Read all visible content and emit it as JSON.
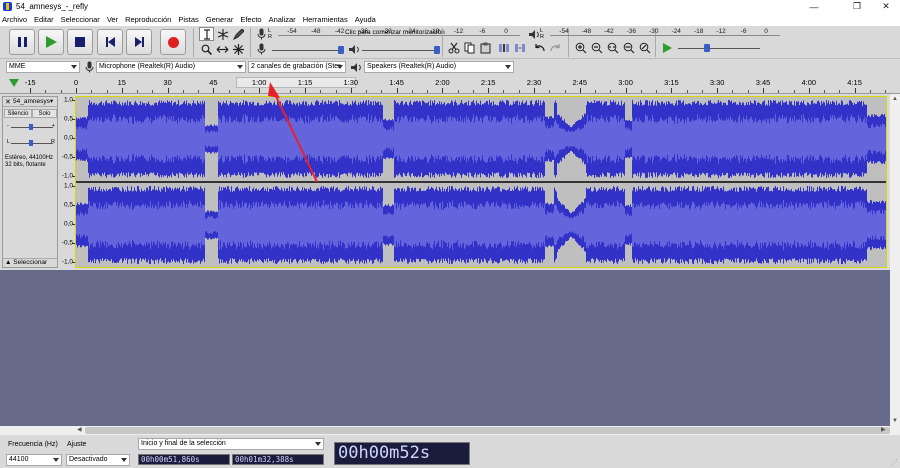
{
  "window": {
    "title": "54_amnesys_-_refly",
    "minimize": "—",
    "maximize": "❐",
    "close": "✕"
  },
  "menu": [
    "Archivo",
    "Editar",
    "Seleccionar",
    "Ver",
    "Reproducción",
    "Pistas",
    "Generar",
    "Efecto",
    "Analizar",
    "Herramientas",
    "Ayuda"
  ],
  "transport": {
    "pause": "Pausa",
    "play": "Reproducir",
    "stop": "Detener",
    "skip_start": "Saltar al inicio",
    "skip_end": "Saltar al final",
    "record": "Grabar"
  },
  "meters": {
    "record_ticks": [
      "-54",
      "-48",
      "-42",
      "-36",
      "-30",
      "-24",
      "-18",
      "-12",
      "-6",
      "0"
    ],
    "record_hint": "Clic para comenzar monitorización",
    "play_ticks": [
      "-54",
      "-48",
      "-42",
      "-36",
      "-30",
      "-24",
      "-18",
      "-12",
      "-6",
      "0"
    ],
    "lr_left": "L",
    "lr_right": "R"
  },
  "device": {
    "host": "MME",
    "mic": "Microphone (Realtek(R) Audio)",
    "channels": "2 canales de grabación (Ster",
    "speakers": "Speakers (Realtek(R) Audio)"
  },
  "ruler": {
    "labels": [
      "-15",
      "0",
      "15",
      "30",
      "45",
      "1:00",
      "1:15",
      "1:30",
      "1:45",
      "2:00",
      "2:15",
      "2:30",
      "2:45",
      "3:00",
      "3:15",
      "3:30",
      "3:45",
      "4:00",
      "4:15"
    ]
  },
  "track": {
    "name": "54_amnesys",
    "close": "✕",
    "dropdown": "▾",
    "mute": "Silencio",
    "solo": "Solo",
    "gain_minus": "-",
    "gain_plus": "+",
    "pan_left": "L",
    "pan_right": "R",
    "info_line1": "Estéreo, 44100Hz",
    "info_line2": "32 bits, flotante",
    "select": "Seleccionar",
    "collapse": "▲",
    "scale": [
      "1,0",
      "0,5",
      "0,0",
      "-0,5",
      "-1,0"
    ]
  },
  "selection_toolbar": {
    "rate_label": "Frecuencia (Hz)",
    "rate_value": "44100",
    "snap_label": "Ajuste",
    "snap_value": "Desactivado",
    "range_label": "Inicio y final de la selección",
    "start": "00h00m51,860s",
    "end": "00h01m32,388s",
    "position": "00h00m52s"
  },
  "colors": {
    "wave": "#3232c8",
    "wave_light": "#6464dc",
    "track_bg": "#bfbfbf",
    "empty": "#676b89",
    "annotation_arrow": "#e8202a"
  },
  "icons": [
    "select-tool-icon",
    "envelope-tool-icon",
    "draw-tool-icon",
    "zoom-tool-icon",
    "timeshift-tool-icon",
    "multi-tool-icon",
    "microphone-icon",
    "speaker-icon",
    "cut-icon",
    "copy-icon",
    "paste-icon",
    "trim-icon",
    "silence-icon",
    "undo-icon",
    "redo-icon",
    "zoom-in-icon",
    "zoom-out-icon",
    "fit-selection-icon",
    "fit-project-icon",
    "zoom-toggle-icon",
    "play-at-speed-icon"
  ]
}
